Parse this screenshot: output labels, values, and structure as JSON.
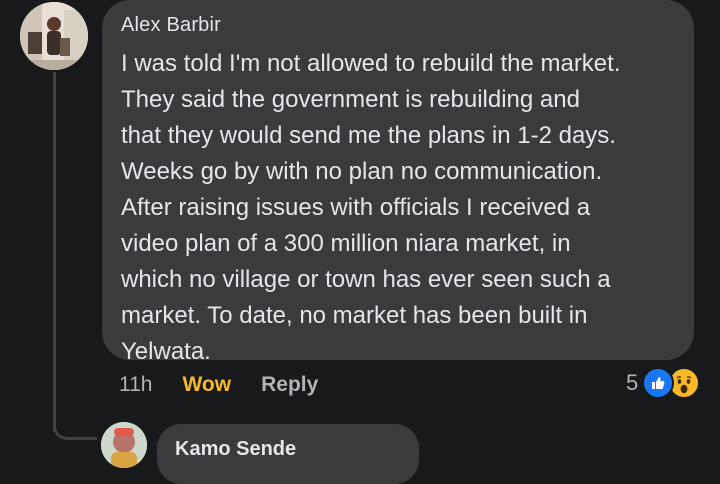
{
  "comment": {
    "author": "Alex Barbir",
    "text_lines": [
      "I was told I'm not allowed to rebuild the market.",
      "They said the government is rebuilding and",
      "that they would send me the plans in 1-2 days.",
      "Weeks go by with no plan no communication.",
      "After raising issues with officials I received a",
      "video plan of a 300 million niara market, in",
      "which no village or town has ever seen such a",
      "market. To date, no market has been built in",
      "Yelwata."
    ],
    "timestamp": "11h",
    "reaction_label": "Wow",
    "reply_label": "Reply",
    "reaction_count": "5",
    "reaction_icons": [
      "like-icon",
      "wow-icon"
    ],
    "colors": {
      "wow": "#f7b928",
      "like": "#1877f2",
      "bubble": "#3a3b3c",
      "background": "#18191a"
    }
  },
  "reply": {
    "author": "Kamo Sende"
  }
}
